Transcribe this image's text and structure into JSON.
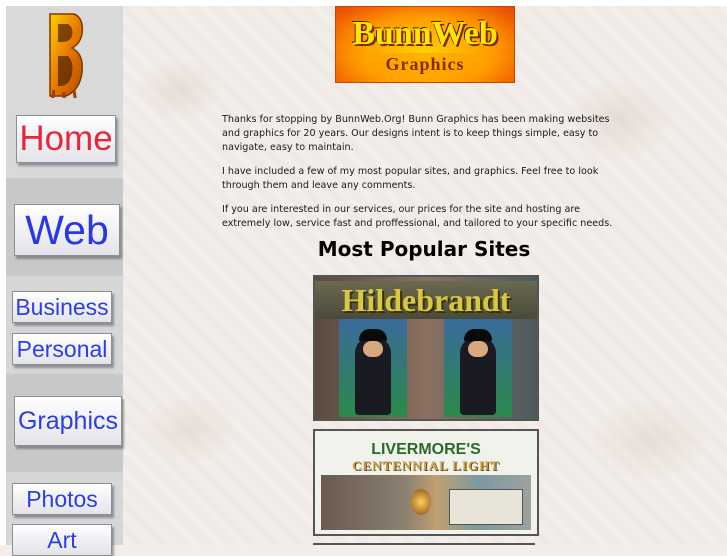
{
  "sidebar": {
    "logo_icon": "bunnweb-b-logo-icon",
    "nav": {
      "home": "Home",
      "web": "Web",
      "business": "Business",
      "personal": "Personal",
      "graphics": "Graphics",
      "photos": "Photos",
      "art": "Art"
    }
  },
  "header": {
    "logo_line1": "BunnWeb",
    "logo_line2": "Graphics"
  },
  "intro": {
    "p1": "Thanks for stopping by BunnWeb.Org! Bunn Graphics has been making websites and graphics for 20 years. Our designs intent is to keep things simple, easy to navigate, easy to maintain.",
    "p2": "I have included a few of my most popular sites, and graphics. Feel free to look through them and leave any comments.",
    "p3": "If you are interested in our services, our prices for the site and hosting are extremely low, service fast and proffessional, and tailored to your specific needs."
  },
  "popular": {
    "title": "Most Popular Sites",
    "sites": [
      {
        "title": "Hildebrandt"
      },
      {
        "line1": "LIVERMORE'S",
        "line2": "CENTENNIAL LIGHT"
      }
    ]
  },
  "colors": {
    "home_text": "#e8263a",
    "nav_text": "#2a3fe8",
    "logo_orange": "#ff9a00",
    "logo_yellow": "#ffe600"
  }
}
